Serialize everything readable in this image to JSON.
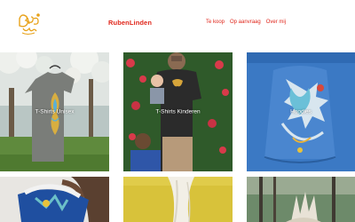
{
  "header": {
    "logo_alt": "Ruben Linden",
    "brand": "RubenLinden",
    "nav": [
      {
        "label": "Te koop"
      },
      {
        "label": "Op aanvraag"
      },
      {
        "label": "Over mij"
      }
    ]
  },
  "colors": {
    "accent": "#e0261b",
    "logo": "#e8a21a"
  },
  "tiles": [
    {
      "label": "T-Shirts Unisex"
    },
    {
      "label": "T-Shirts Kinderen"
    },
    {
      "label": "Hoodies"
    },
    {
      "label": ""
    },
    {
      "label": ""
    },
    {
      "label": ""
    }
  ]
}
